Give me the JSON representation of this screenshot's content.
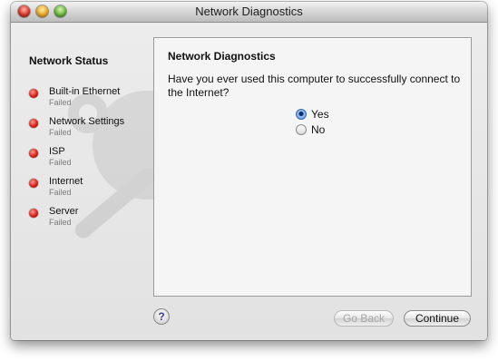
{
  "window": {
    "title": "Network Diagnostics"
  },
  "sidebar": {
    "title": "Network Status",
    "items": [
      {
        "label": "Built-in Ethernet",
        "status": "Failed",
        "led": "red"
      },
      {
        "label": "Network Settings",
        "status": "Failed",
        "led": "red"
      },
      {
        "label": "ISP",
        "status": "Failed",
        "led": "red"
      },
      {
        "label": "Internet",
        "status": "Failed",
        "led": "red"
      },
      {
        "label": "Server",
        "status": "Failed",
        "led": "red"
      }
    ]
  },
  "panel": {
    "title": "Network Diagnostics",
    "question": "Have you ever used this computer to successfully connect to the Internet?",
    "options": [
      {
        "label": "Yes",
        "selected": true
      },
      {
        "label": "No",
        "selected": false
      }
    ]
  },
  "footer": {
    "help_label": "?",
    "back_label": "Go Back",
    "back_enabled": false,
    "continue_label": "Continue"
  },
  "colors": {
    "status_failed": "#d81e14",
    "accent": "#4c8fe0"
  }
}
